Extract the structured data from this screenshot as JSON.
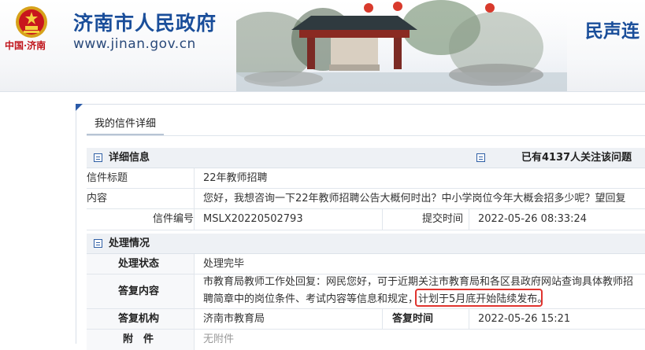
{
  "header": {
    "site_title": "济南市人民政府",
    "site_url": "www.jinan.gov.cn",
    "slogan": "中国·济南",
    "channel": "民声连",
    "emblem_icon": "national-emblem-icon",
    "banner_image": "pavilion-scenery"
  },
  "tab": {
    "label": "我的信件详细"
  },
  "detail": {
    "section_title": "详细信息",
    "followers": "已有4137人关注该问题",
    "rows": {
      "title_label": "信件标题",
      "title_value": "22年教师招聘",
      "content_label": "内容",
      "content_value": "您好，我想咨询一下22年教师招聘公告大概何时出？中小学岗位今年大概会招多少呢？望回复",
      "number_label": "信件编号",
      "number_value": "MSLX20220502793",
      "submit_label": "提交时间",
      "submit_value": "2022-05-26 08:33:24"
    }
  },
  "handling": {
    "section_title": "处理情况",
    "status_label": "处理状态",
    "status_value": "处理完毕",
    "reply_label": "答复内容",
    "reply_line1": "市教育局教师工作处回复：网民您好，可于近期关注市教育局和各区县政府网站查询具体教师招",
    "reply_line2a": "聘简章中的岗位条件、考试内容等信息和规定，",
    "reply_line2b": "计划于5月底开始陆续发布。",
    "org_label": "答复机构",
    "org_value": "济南市教育局",
    "reply_time_label": "答复时间",
    "reply_time_value": "2022-05-26 15:21",
    "attach_label": "附　件",
    "attach_value": "无附件"
  },
  "colors": {
    "brand_blue": "#1a4e9a",
    "highlight_red": "#e0342f",
    "slogan_red": "#c0141b"
  }
}
